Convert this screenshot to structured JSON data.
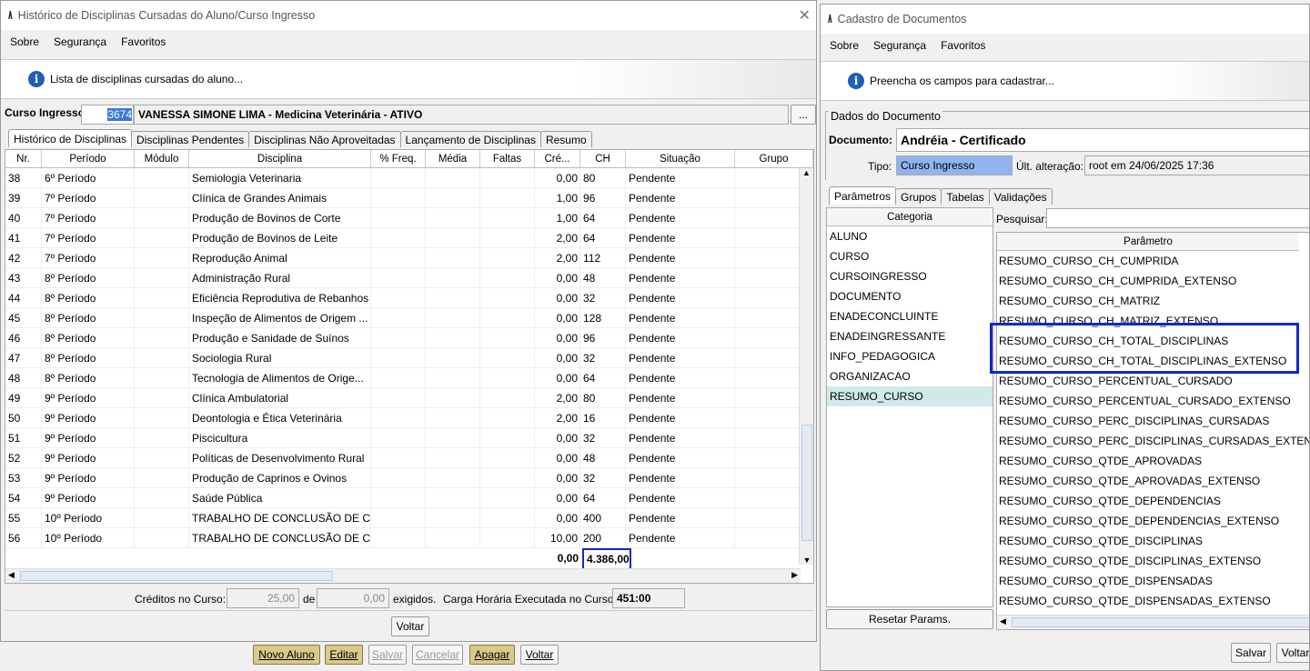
{
  "left_window": {
    "title": "Histórico de Disciplinas Cursadas do Aluno/Curso Ingresso",
    "menu": [
      "Sobre",
      "Segurança",
      "Favoritos"
    ],
    "info_text": "Lista de disciplinas cursadas do aluno...",
    "curso_label": "Curso Ingresso:",
    "curso_code": "3674",
    "curso_name": "VANESSA SIMONE LIMA - Medicina Veterinária - ATIVO",
    "ellipsis": "...",
    "tabs": [
      "Histórico de Disciplinas",
      "Disciplinas Pendentes",
      "Disciplinas Não Aproveitadas",
      "Lançamento de Disciplinas",
      "Resumo"
    ],
    "columns": [
      "Nr.",
      "Período",
      "Módulo",
      "Disciplina",
      "% Freq.",
      "Média",
      "Faltas",
      "Cré...",
      "CH",
      "Situação",
      "Grupo"
    ],
    "rows": [
      {
        "nr": "38",
        "periodo": "6º Período",
        "disciplina": "Semiologia Veterinaria",
        "cred": "0,00",
        "ch": "80",
        "situacao": "Pendente"
      },
      {
        "nr": "39",
        "periodo": "7º Período",
        "disciplina": "Clínica de Grandes Animais",
        "cred": "1,00",
        "ch": "96",
        "situacao": "Pendente"
      },
      {
        "nr": "40",
        "periodo": "7º Período",
        "disciplina": "Produção de Bovinos de Corte",
        "cred": "1,00",
        "ch": "64",
        "situacao": "Pendente"
      },
      {
        "nr": "41",
        "periodo": "7º Período",
        "disciplina": "Produção de Bovinos de Leite",
        "cred": "2,00",
        "ch": "64",
        "situacao": "Pendente"
      },
      {
        "nr": "42",
        "periodo": "7º Período",
        "disciplina": "Reprodução Animal",
        "cred": "2,00",
        "ch": "112",
        "situacao": "Pendente"
      },
      {
        "nr": "43",
        "periodo": "8º Período",
        "disciplina": "Administração Rural",
        "cred": "0,00",
        "ch": "48",
        "situacao": "Pendente"
      },
      {
        "nr": "44",
        "periodo": "8º Período",
        "disciplina": "Eficiência Reprodutiva de Rebanhos",
        "cred": "0,00",
        "ch": "32",
        "situacao": "Pendente"
      },
      {
        "nr": "45",
        "periodo": "8º Período",
        "disciplina": "Inspeção de Alimentos de Origem ...",
        "cred": "0,00",
        "ch": "128",
        "situacao": "Pendente"
      },
      {
        "nr": "46",
        "periodo": "8º Período",
        "disciplina": "Produção e Sanidade de Suínos",
        "cred": "0,00",
        "ch": "96",
        "situacao": "Pendente"
      },
      {
        "nr": "47",
        "periodo": "8º Período",
        "disciplina": "Sociologia Rural",
        "cred": "0,00",
        "ch": "32",
        "situacao": "Pendente"
      },
      {
        "nr": "48",
        "periodo": "8º Período",
        "disciplina": "Tecnologia de Alimentos de Orige...",
        "cred": "0,00",
        "ch": "64",
        "situacao": "Pendente"
      },
      {
        "nr": "49",
        "periodo": "9º Período",
        "disciplina": "Clínica Ambulatorial",
        "cred": "2,00",
        "ch": "80",
        "situacao": "Pendente"
      },
      {
        "nr": "50",
        "periodo": "9º Período",
        "disciplina": "Deontologia e Ética Veterinária",
        "cred": "2,00",
        "ch": "16",
        "situacao": "Pendente"
      },
      {
        "nr": "51",
        "periodo": "9º Período",
        "disciplina": "Piscicultura",
        "cred": "0,00",
        "ch": "32",
        "situacao": "Pendente"
      },
      {
        "nr": "52",
        "periodo": "9º Período",
        "disciplina": "Políticas de Desenvolvimento Rural",
        "cred": "0,00",
        "ch": "48",
        "situacao": "Pendente"
      },
      {
        "nr": "53",
        "periodo": "9º Período",
        "disciplina": "Produção de Caprinos e Ovinos",
        "cred": "0,00",
        "ch": "32",
        "situacao": "Pendente"
      },
      {
        "nr": "54",
        "periodo": "9º Período",
        "disciplina": "Saúde Pública",
        "cred": "0,00",
        "ch": "64",
        "situacao": "Pendente"
      },
      {
        "nr": "55",
        "periodo": "10º Período",
        "disciplina": "TRABALHO DE CONCLUSÃO DE CU...",
        "cred": "0,00",
        "ch": "400",
        "situacao": "Pendente"
      },
      {
        "nr": "56",
        "periodo": "10º Período",
        "disciplina": "TRABALHO DE CONCLUSÃO DE CU...",
        "cred": "10,00",
        "ch": "200",
        "situacao": "Pendente"
      }
    ],
    "total_cred": "0,00",
    "total_ch": "4.386,00",
    "footer": {
      "creditos_label": "Créditos no Curso:",
      "creditos_value": "25,00",
      "de_label": "de",
      "exigidos_value": "0,00",
      "exigidos_label": "exigidos.",
      "carga_label": "Carga Horária Executada no Curso:",
      "carga_value": "451:00"
    },
    "voltar": "Voltar"
  },
  "bottom_buttons": {
    "novo_aluno": "Novo Aluno",
    "editar": "Editar",
    "salvar": "Salvar",
    "cancelar": "Cancelar",
    "apagar": "Apagar",
    "voltar": "Voltar"
  },
  "right_window": {
    "title": "Cadastro de Documentos",
    "menu": [
      "Sobre",
      "Segurança",
      "Favoritos"
    ],
    "info_text": "Preencha os campos para cadastrar...",
    "group_label": "Dados do Documento",
    "documento_label": "Documento:",
    "documento_value": "Andréia - Certificado",
    "tipo_label": "Tipo:",
    "tipo_value": "Curso Ingresso",
    "alteracao_label": "Últ. alteração:",
    "alteracao_value": "root em 24/06/2025 17:36",
    "tabs": [
      "Parâmetros",
      "Grupos",
      "Tabelas",
      "Validações"
    ],
    "categoria_header": "Categoria",
    "categorias": [
      "ALUNO",
      "CURSO",
      "CURSOINGRESSO",
      "DOCUMENTO",
      "ENADECONCLUINTE",
      "ENADEINGRESSANTE",
      "INFO_PEDAGOGICA",
      "ORGANIZACAO",
      "RESUMO_CURSO"
    ],
    "selected_categoria": "RESUMO_CURSO",
    "pesquisar_label": "Pesquisar:",
    "parametro_header": "Parâmetro",
    "parametros": [
      "RESUMO_CURSO_CH_CUMPRIDA",
      "RESUMO_CURSO_CH_CUMPRIDA_EXTENSO",
      "RESUMO_CURSO_CH_MATRIZ",
      "RESUMO_CURSO_CH_MATRIZ_EXTENSO",
      "RESUMO_CURSO_CH_TOTAL_DISCIPLINAS",
      "RESUMO_CURSO_CH_TOTAL_DISCIPLINAS_EXTENSO",
      "RESUMO_CURSO_PERCENTUAL_CURSADO",
      "RESUMO_CURSO_PERCENTUAL_CURSADO_EXTENSO",
      "RESUMO_CURSO_PERC_DISCIPLINAS_CURSADAS",
      "RESUMO_CURSO_PERC_DISCIPLINAS_CURSADAS_EXTENSO",
      "RESUMO_CURSO_QTDE_APROVADAS",
      "RESUMO_CURSO_QTDE_APROVADAS_EXTENSO",
      "RESUMO_CURSO_QTDE_DEPENDENCIAS",
      "RESUMO_CURSO_QTDE_DEPENDENCIAS_EXTENSO",
      "RESUMO_CURSO_QTDE_DISCIPLINAS",
      "RESUMO_CURSO_QTDE_DISCIPLINAS_EXTENSO",
      "RESUMO_CURSO_QTDE_DISPENSADAS",
      "RESUMO_CURSO_QTDE_DISPENSADAS_EXTENSO"
    ],
    "resetar": "Resetar Params.",
    "salvar": "Salvar",
    "voltar": "Voltar"
  },
  "colors": {
    "highlight_box": "#1428c8",
    "selected_cat": "#cfeae9",
    "tipo_bg": "#8fb4f0",
    "gold_button": "#d9c98a"
  }
}
